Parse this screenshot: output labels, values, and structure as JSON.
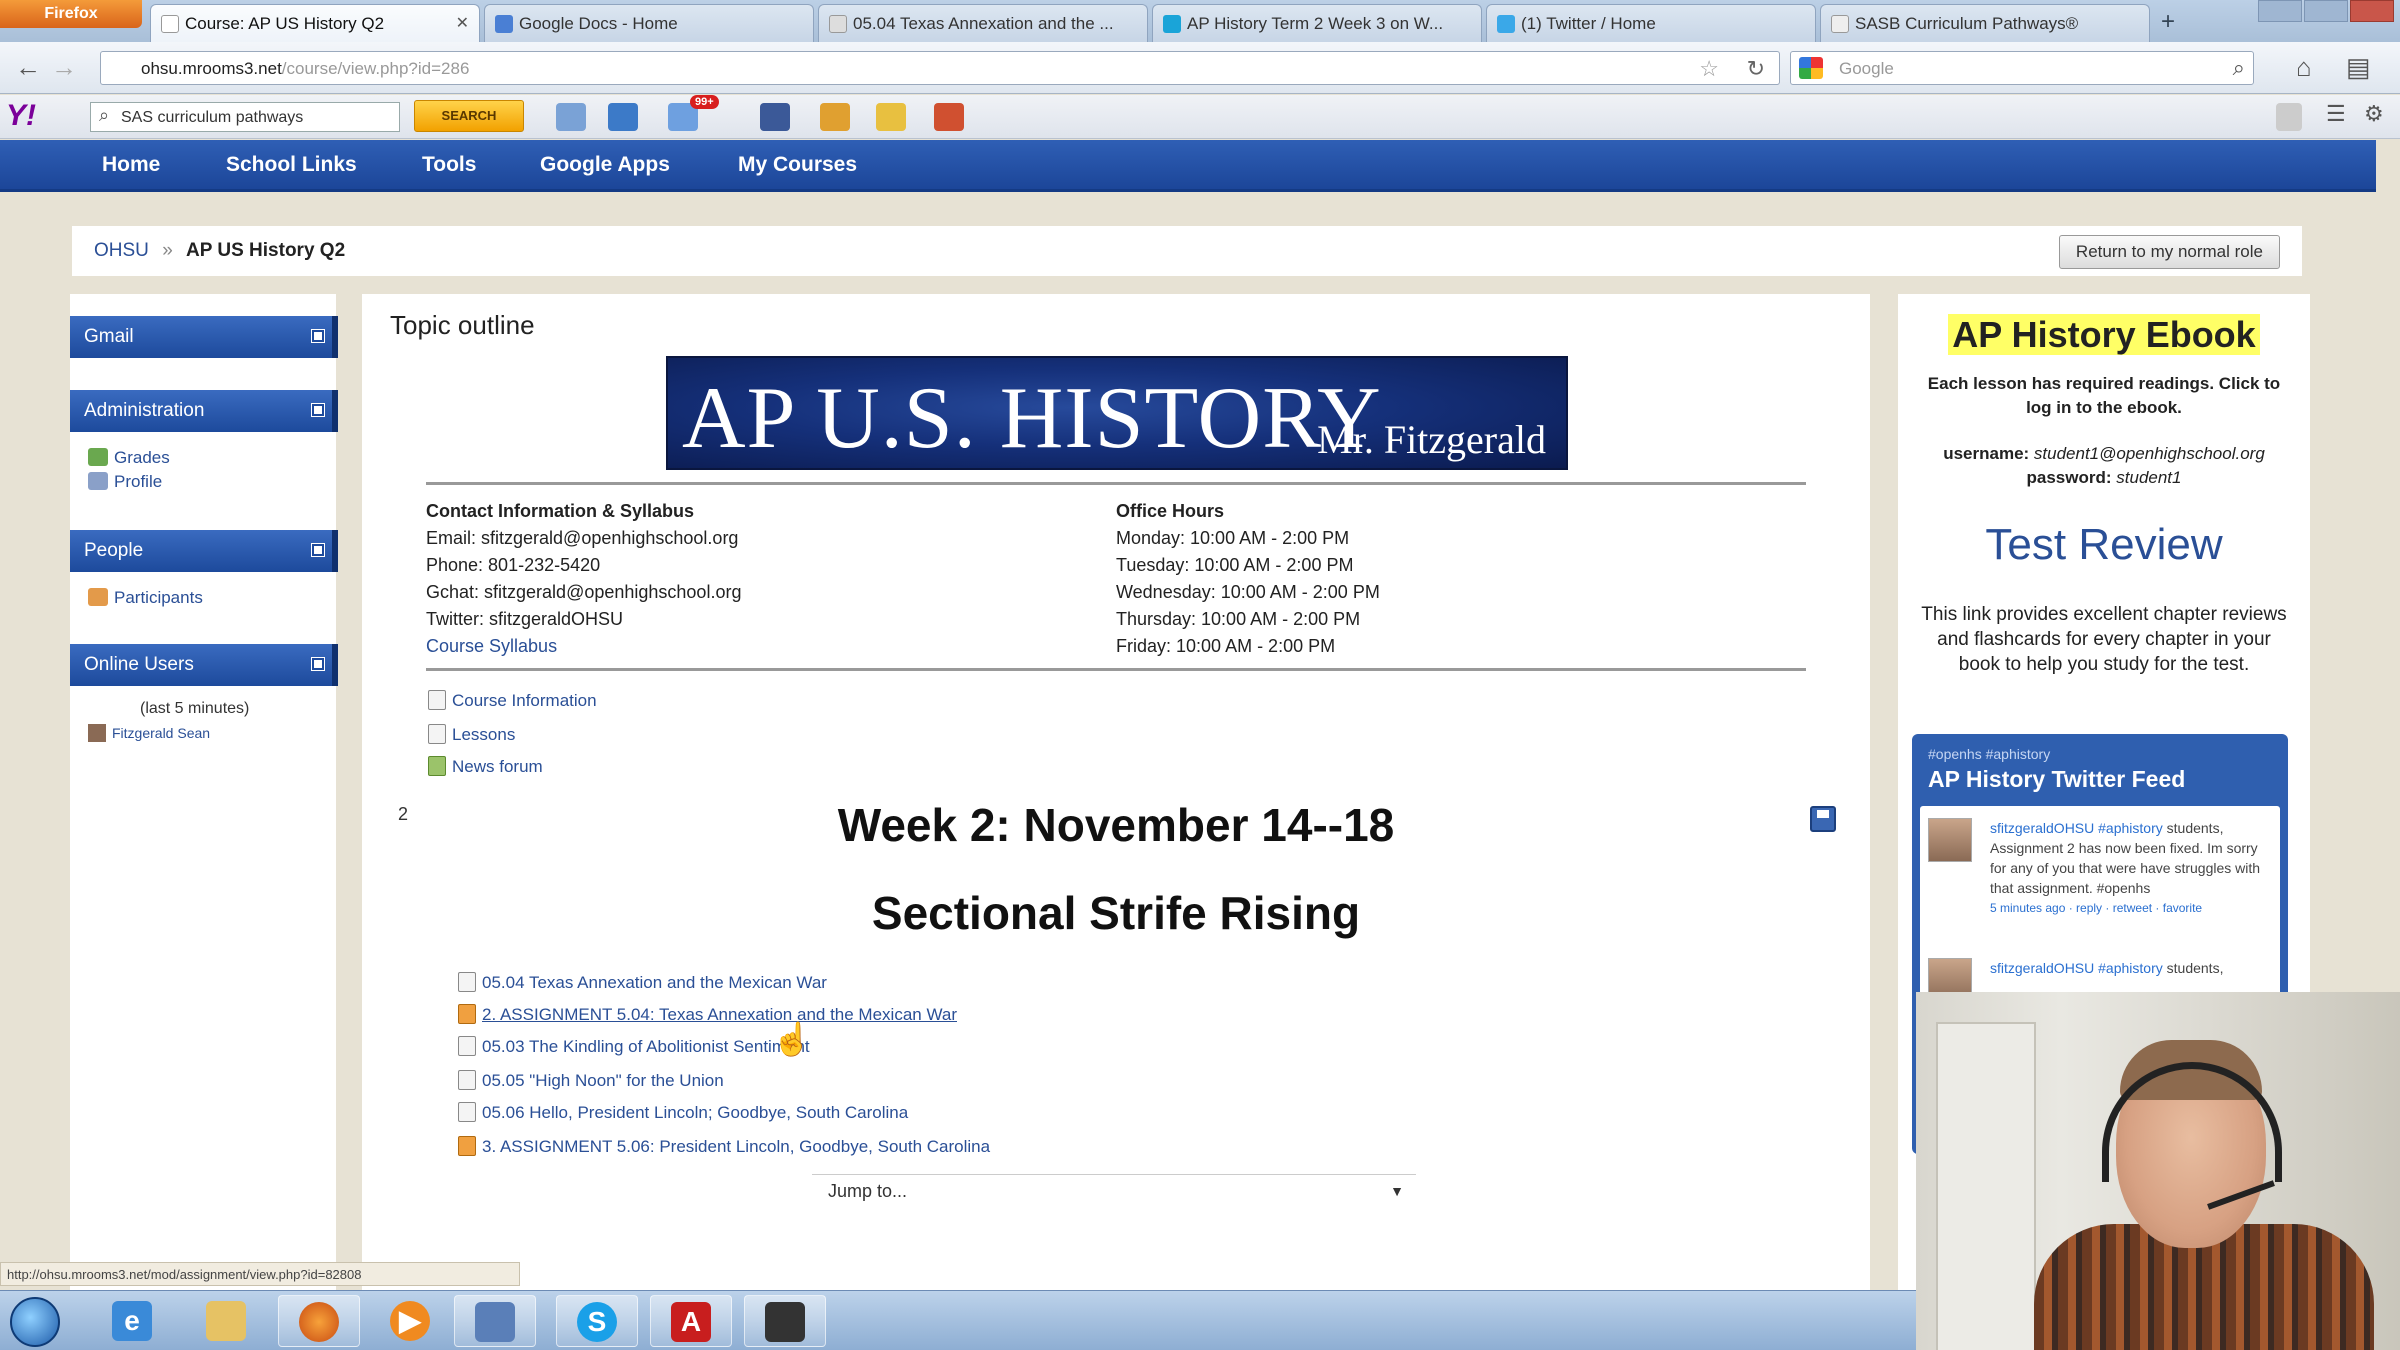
{
  "browser": {
    "app_button": "Firefox",
    "tabs": [
      {
        "title": "Course: AP US History Q2",
        "active": true
      },
      {
        "title": "Google Docs - Home",
        "active": false
      },
      {
        "title": "05.04 Texas Annexation and the ...",
        "active": false
      },
      {
        "title": "AP History Term 2 Week 3 on W...",
        "active": false
      },
      {
        "title": "(1) Twitter / Home",
        "active": false
      },
      {
        "title": "SASB Curriculum Pathways®",
        "active": false
      }
    ],
    "url_host": "ohsu.mrooms3.net",
    "url_path": "/course/view.php?id=286",
    "search_placeholder": "Google"
  },
  "yahoo_toolbar": {
    "logo": "Y!",
    "search_value": "SAS curriculum pathways",
    "search_button": "SEARCH",
    "mail_badge": "99+"
  },
  "site_nav": [
    "Home",
    "School Links",
    "Tools",
    "Google Apps",
    "My Courses"
  ],
  "breadcrumb": {
    "root": "OHSU",
    "separator": "»",
    "current": "AP US History Q2"
  },
  "return_button": "Return to my normal role",
  "left_blocks": {
    "gmail": {
      "title": "Gmail"
    },
    "administration": {
      "title": "Administration",
      "items": [
        "Grades",
        "Profile"
      ]
    },
    "people": {
      "title": "People",
      "items": [
        "Participants"
      ]
    },
    "online_users": {
      "title": "Online Users",
      "note": "(last 5 minutes)",
      "user": "Fitzgerald Sean"
    }
  },
  "main": {
    "topic_outline": "Topic outline",
    "banner_title": "AP U.S. HISTORY",
    "banner_sub": "Mr. Fitzgerald",
    "contact": {
      "heading": "Contact Information & Syllabus",
      "email": "Email: sfitzgerald@openhighschool.org",
      "phone": "Phone: 801-232-5420",
      "gchat": "Gchat: sfitzgerald@openhighschool.org",
      "twitter": "Twitter: sfitzgeraldOHSU",
      "syllabus_link": "Course Syllabus"
    },
    "hours": {
      "heading": "Office Hours",
      "days": [
        "Monday: 10:00 AM - 2:00 PM",
        "Tuesday: 10:00 AM - 2:00 PM",
        "Wednesday: 10:00 AM - 2:00 PM",
        "Thursday: 10:00 AM - 2:00 PM",
        "Friday: 10:00 AM - 2:00 PM"
      ]
    },
    "resources": [
      "Course Information",
      "Lessons",
      "News forum"
    ],
    "section_number": "2",
    "week_title": "Week 2: November 14--18",
    "week_subtitle": "Sectional Strife Rising",
    "activities": [
      {
        "label": "05.04 Texas Annexation and the Mexican War",
        "type": "resource"
      },
      {
        "label": "2. ASSIGNMENT 5.04: Texas Annexation and the Mexican War",
        "type": "assignment"
      },
      {
        "label": "05.03 The Kindling of Abolitionist Sentiment",
        "type": "resource"
      },
      {
        "label": "05.05 \"High Noon\" for the Union",
        "type": "resource"
      },
      {
        "label": "05.06 Hello, President Lincoln; Goodbye, South Carolina",
        "type": "resource"
      },
      {
        "label": "3. ASSIGNMENT 5.06: President Lincoln, Goodbye, South Carolina",
        "type": "assignment"
      }
    ],
    "jump_to": "Jump to..."
  },
  "right": {
    "ebook_title": "AP History Ebook",
    "ebook_desc": "Each lesson has required readings. Click to log in to the ebook.",
    "username_label": "username:",
    "username_value": "student1@openhighschool.org",
    "password_label": "password:",
    "password_value": "student1",
    "test_review": "Test Review",
    "test_desc": "This link provides excellent chapter reviews and flashcards for every chapter in your book to help you study for the test.",
    "twitter_small": "#openhs #aphistory",
    "twitter_title": "AP History Twitter Feed",
    "tweets": [
      {
        "user": "sfitzgeraldOHSU #aphistory",
        "text": "students, Assignment 2 has now been fixed. Im sorry for any of you that were have struggles with that assignment. #openhs",
        "meta": "5 minutes ago · reply · retweet · favorite"
      },
      {
        "user": "sfitzgeraldOHSU #aphistory",
        "text": "students,",
        "meta": ""
      }
    ]
  },
  "status_bar": "http://ohsu.mrooms3.net/mod/assignment/view.php?id=82808",
  "colors": {
    "nav_blue": "#1c4699",
    "link": "#2a4f96",
    "highlight": "#ffff66",
    "banner": "#15307a"
  }
}
